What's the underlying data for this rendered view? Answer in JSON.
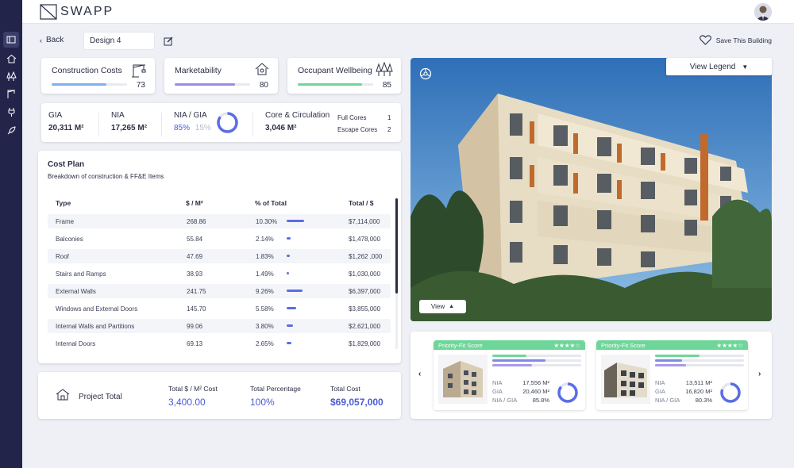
{
  "app": {
    "logo": "SWAPP"
  },
  "nav": {
    "back_label": "Back",
    "design_name": "Design 4",
    "save_label": "Save This Building"
  },
  "kpis": [
    {
      "title": "Construction Costs",
      "value": "73",
      "fraction": 0.73,
      "color": "#7fb0ee",
      "icon": "crane-icon"
    },
    {
      "title": "Marketability",
      "value": "80",
      "fraction": 0.8,
      "color": "#9b8be8",
      "icon": "house-hand-icon"
    },
    {
      "title": "Occupant Wellbeing",
      "value": "85",
      "fraction": 0.85,
      "color": "#6fd69a",
      "icon": "trees-icon"
    }
  ],
  "metrics": {
    "gia_label": "GIA",
    "gia_value": "20,311 M²",
    "nia_label": "NIA",
    "nia_value": "17,265 M²",
    "ratio_label": "NIA / GIA",
    "ratio_value": "85%",
    "ratio_rest": "15%",
    "ratio_fraction": 0.85,
    "core_label": "Core & Circulation",
    "core_value": "3,046 M²",
    "full_cores_label": "Full Cores",
    "full_cores_value": "1",
    "escape_cores_label": "Escape Cores",
    "escape_cores_value": "2"
  },
  "cost_plan": {
    "title": "Cost Plan",
    "subtitle": "Breakdown of construction & FF&E Items",
    "columns": [
      "Type",
      "$ / M²",
      "% of Total",
      "Total / $"
    ],
    "rows": [
      {
        "type": "Frame",
        "per_m2": "268.86",
        "pct": "10.30%",
        "pct_num": 10.3,
        "total": "$7,114,000"
      },
      {
        "type": "Balconies",
        "per_m2": "55.84",
        "pct": "2.14%",
        "pct_num": 2.14,
        "total": "$1,478,000"
      },
      {
        "type": "Roof",
        "per_m2": "47.69",
        "pct": "1.83%",
        "pct_num": 1.83,
        "total": "$1,262 ,000"
      },
      {
        "type": "Stairs and Ramps",
        "per_m2": "38.93",
        "pct": "1.49%",
        "pct_num": 1.49,
        "total": "$1,030,000"
      },
      {
        "type": "External Walls",
        "per_m2": "241.75",
        "pct": "9.26%",
        "pct_num": 9.26,
        "total": "$6,397,000"
      },
      {
        "type": "Windows and External Doors",
        "per_m2": "145.70",
        "pct": "5.58%",
        "pct_num": 5.58,
        "total": "$3,855,000"
      },
      {
        "type": "Internal Walls and Partitions",
        "per_m2": "99.06",
        "pct": "3.80%",
        "pct_num": 3.8,
        "total": "$2,621,000"
      },
      {
        "type": "Internal Doors",
        "per_m2": "69.13",
        "pct": "2.65%",
        "pct_num": 2.65,
        "total": "$1,829,000"
      }
    ]
  },
  "project_total": {
    "label": "Project Total",
    "per_m2_label": "Total $ / M² Cost",
    "per_m2_value": "3,400.00",
    "pct_label": "Total Percentage",
    "pct_value": "100%",
    "cost_label": "Total Cost",
    "cost_value": "$69,057,000"
  },
  "viewer": {
    "legend_label": "View Legend",
    "view_label": "View"
  },
  "options": [
    {
      "header": "Priority-Fit Score",
      "stars": "★★★★☆",
      "bars": [
        0.38,
        0.6,
        0.45
      ],
      "nia_label": "NIA",
      "nia_value": "17,556  M²",
      "gia_label": "GIA",
      "gia_value": "20,460  M²",
      "ratio_label": "NIA / GIA",
      "ratio_value": "85.8%",
      "ratio_fraction": 0.858
    },
    {
      "header": "Priority-Fit Score",
      "stars": "★★★★☆",
      "bars": [
        0.5,
        0.3,
        0.35
      ],
      "nia_label": "NIA",
      "nia_value": "13,511  M²",
      "gia_label": "GIA",
      "gia_value": "16,820  M²",
      "ratio_label": "NIA / GIA",
      "ratio_value": "80.3%",
      "ratio_fraction": 0.803
    }
  ],
  "colors": {
    "sidebar": "#22244a",
    "accent": "#4a5bd8",
    "green": "#6fd69a"
  }
}
